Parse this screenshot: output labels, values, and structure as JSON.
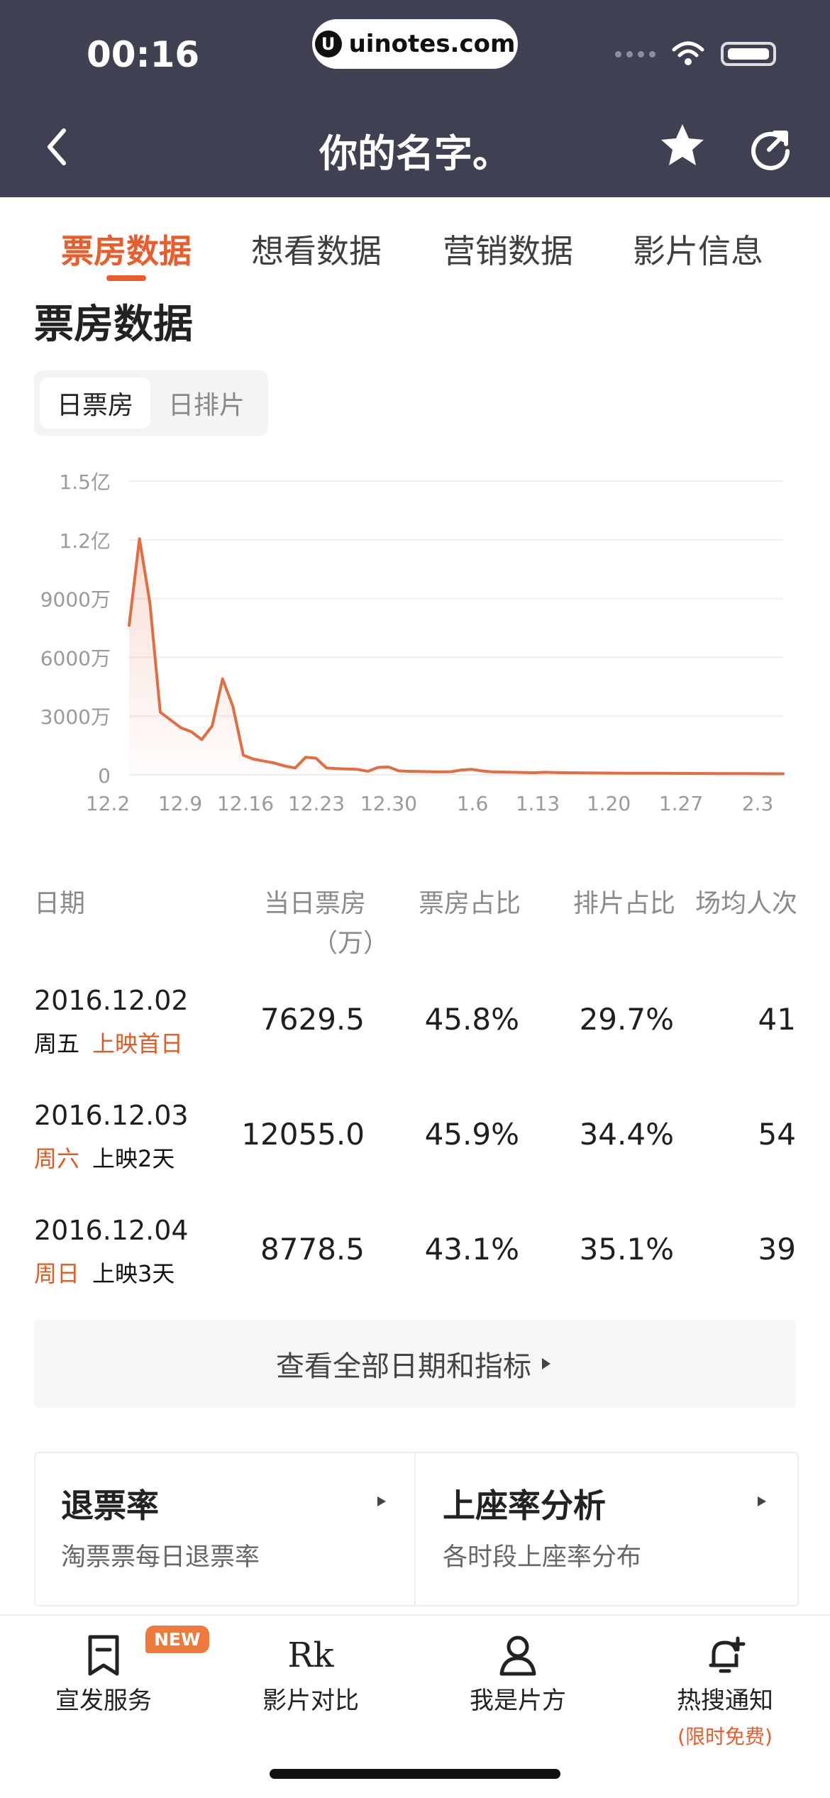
{
  "status": {
    "time": "00:16",
    "url": "uinotes.com"
  },
  "nav": {
    "title": "你的名字。"
  },
  "tabs": [
    {
      "label": "票房数据",
      "active": true
    },
    {
      "label": "想看数据",
      "active": false
    },
    {
      "label": "营销数据",
      "active": false
    },
    {
      "label": "影片信息",
      "active": false
    }
  ],
  "section": {
    "title": "票房数据",
    "segments": [
      "日票房",
      "日排片"
    ]
  },
  "colors": {
    "accent": "#ea5c2b",
    "header_bg": "#3f4051",
    "line": "#e36d43",
    "grid": "#eeeeee",
    "axis_text": "#9a9a9a"
  },
  "chart_data": {
    "type": "area",
    "y_axis": {
      "min": 0,
      "max": 15000,
      "ticks": [
        {
          "value": 0,
          "label": "0"
        },
        {
          "value": 3000,
          "label": "3000万"
        },
        {
          "value": 6000,
          "label": "6000万"
        },
        {
          "value": 9000,
          "label": "9000万"
        },
        {
          "value": 12000,
          "label": "1.2亿"
        },
        {
          "value": 15000,
          "label": "1.5亿"
        }
      ]
    },
    "x_labels": [
      "12.2",
      "12.9",
      "12.16",
      "12.23",
      "12.30",
      "1.6",
      "1.13",
      "1.20",
      "1.27",
      "2.3"
    ],
    "x_range": [
      "12.2",
      "2.3"
    ],
    "values": [
      7629.5,
      12055.0,
      8778.5,
      3200,
      2800,
      2400,
      2200,
      1800,
      2500,
      4900,
      3500,
      1000,
      800,
      700,
      600,
      450,
      350,
      900,
      850,
      350,
      320,
      300,
      280,
      180,
      380,
      400,
      200,
      180,
      170,
      160,
      150,
      160,
      250,
      280,
      200,
      150,
      140,
      130,
      120,
      110,
      130,
      120,
      110,
      105,
      100,
      95,
      90,
      88,
      85,
      82,
      80,
      78,
      76,
      74,
      72,
      70,
      68,
      66,
      64,
      62,
      60,
      58,
      56,
      55
    ]
  },
  "table": {
    "headers": [
      {
        "line1": "日期",
        "line2": ""
      },
      {
        "line1": "当日票房",
        "line2": "（万）"
      },
      {
        "line1": "票房占比",
        "line2": ""
      },
      {
        "line1": "排片占比",
        "line2": ""
      },
      {
        "line1": "场均人次",
        "line2": ""
      }
    ],
    "rows": [
      {
        "date": "2016.12.02",
        "weekday": "周五",
        "weekday_weekend": false,
        "note": "上映首日",
        "note_highlight": true,
        "box": "7629.5",
        "box_share": "45.8%",
        "screen_share": "29.7%",
        "avg": "41"
      },
      {
        "date": "2016.12.03",
        "weekday": "周六",
        "weekday_weekend": true,
        "note": "上映2天",
        "note_highlight": false,
        "box": "12055.0",
        "box_share": "45.9%",
        "screen_share": "34.4%",
        "avg": "54"
      },
      {
        "date": "2016.12.04",
        "weekday": "周日",
        "weekday_weekend": true,
        "note": "上映3天",
        "note_highlight": false,
        "box": "8778.5",
        "box_share": "43.1%",
        "screen_share": "35.1%",
        "avg": "39"
      }
    ]
  },
  "more": {
    "label": "查看全部日期和指标"
  },
  "cards": [
    {
      "title": "退票率",
      "subtitle": "淘票票每日退票率"
    },
    {
      "title": "上座率分析",
      "subtitle": "各时段上座率分布"
    }
  ],
  "bottom_nav": {
    "items": [
      {
        "label": "宣发服务",
        "sub": ""
      },
      {
        "label": "影片对比",
        "sub": ""
      },
      {
        "label": "我是片方",
        "sub": ""
      },
      {
        "label": "热搜通知",
        "sub": "(限时免费)"
      }
    ],
    "badge": "NEW",
    "rk_glyph": "Rk"
  }
}
